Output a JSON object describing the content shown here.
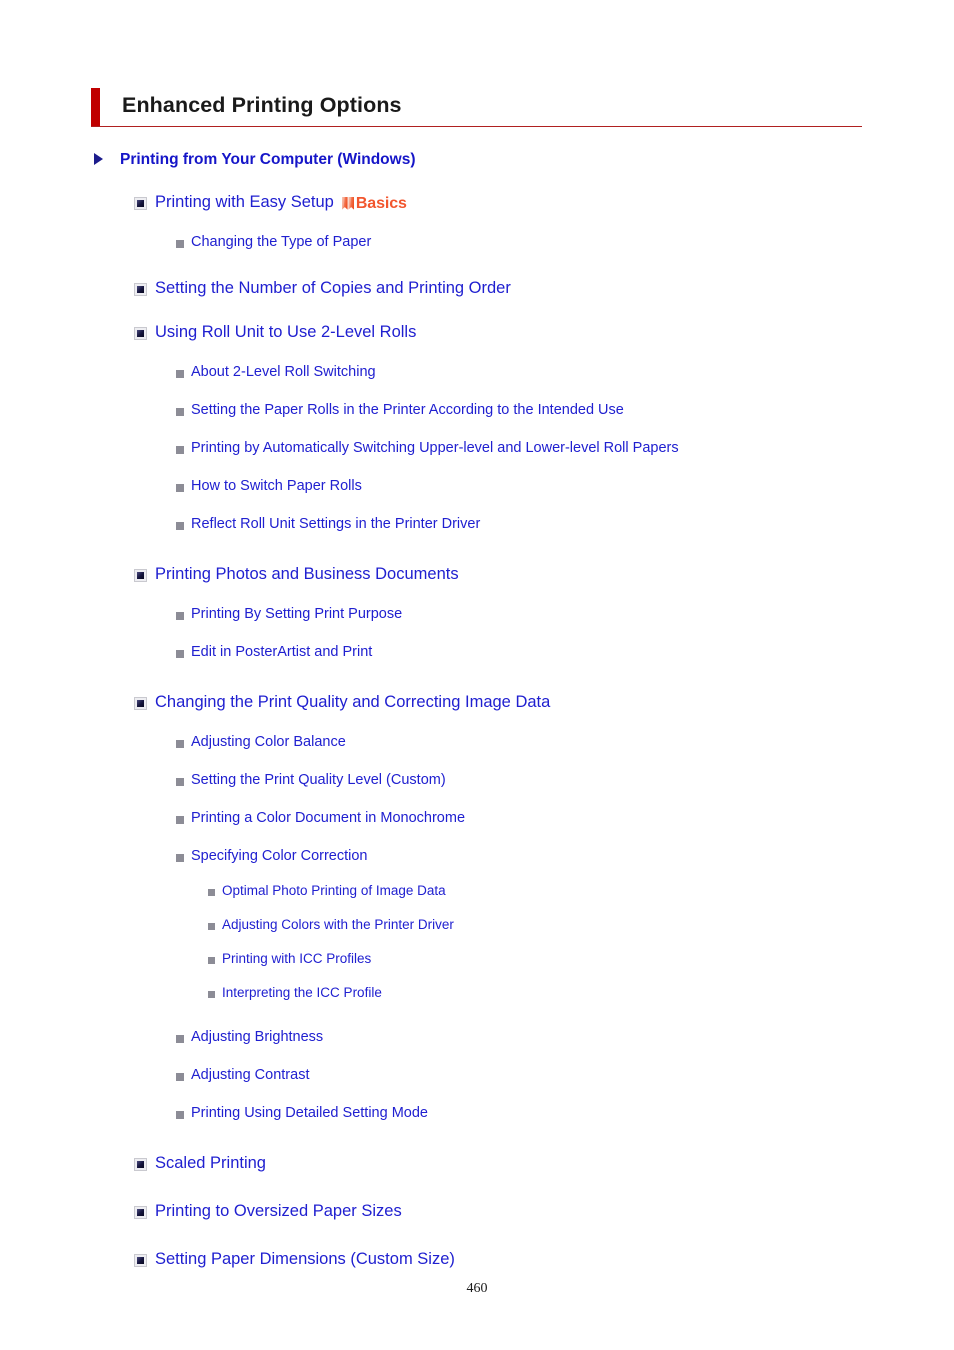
{
  "page": {
    "title": "Enhanced Printing Options",
    "page_number": "460",
    "accent_color": "#c00000",
    "link_color": "#2020d0",
    "badge_color": "#f2562e"
  },
  "toc": {
    "section": {
      "label": "Printing from Your Computer (Windows)",
      "items": [
        {
          "label": "Printing with Easy Setup",
          "badge": "Basics",
          "children": [
            {
              "label": "Changing the Type of Paper"
            }
          ]
        },
        {
          "label": "Setting the Number of Copies and Printing Order",
          "children": []
        },
        {
          "label": "Using Roll Unit to Use 2-Level Rolls",
          "children": [
            {
              "label": "About 2-Level Roll Switching"
            },
            {
              "label": "Setting the Paper Rolls in the Printer According to the Intended Use"
            },
            {
              "label": "Printing by Automatically Switching Upper-level and Lower-level Roll Papers"
            },
            {
              "label": "How to Switch Paper Rolls"
            },
            {
              "label": "Reflect Roll Unit Settings in the Printer Driver"
            }
          ]
        },
        {
          "label": "Printing Photos and Business Documents",
          "children": [
            {
              "label": "Printing By Setting Print Purpose"
            },
            {
              "label": "Edit in PosterArtist and Print"
            }
          ]
        },
        {
          "label": "Changing the Print Quality and Correcting Image Data",
          "children": [
            {
              "label": "Adjusting Color Balance"
            },
            {
              "label": "Setting the Print Quality Level (Custom)"
            },
            {
              "label": "Printing a Color Document in Monochrome"
            },
            {
              "label": "Specifying Color Correction",
              "children": [
                {
                  "label": "Optimal Photo Printing of Image Data"
                },
                {
                  "label": "Adjusting Colors with the Printer Driver"
                },
                {
                  "label": "Printing with ICC Profiles"
                },
                {
                  "label": "Interpreting the ICC Profile"
                }
              ]
            },
            {
              "label": "Adjusting Brightness"
            },
            {
              "label": "Adjusting Contrast"
            },
            {
              "label": "Printing Using Detailed Setting Mode"
            }
          ]
        },
        {
          "label": "Scaled Printing",
          "children": []
        },
        {
          "label": "Printing to Oversized Paper Sizes",
          "children": []
        },
        {
          "label": "Setting Paper Dimensions (Custom Size)",
          "children": []
        }
      ]
    }
  }
}
